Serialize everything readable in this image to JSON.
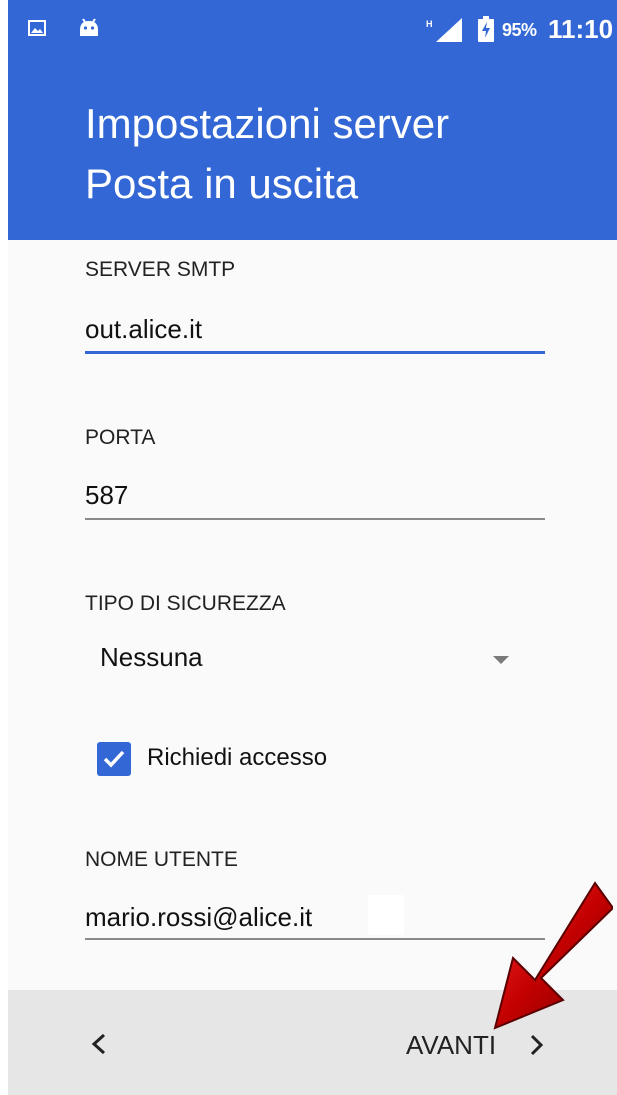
{
  "status_bar": {
    "icons_left": [
      "image-icon",
      "android-icon"
    ],
    "signal_label": "H",
    "battery_percent": "95%",
    "time": "11:10"
  },
  "header": {
    "title_line1": "Impostazioni server",
    "title_line2": "Posta in uscita"
  },
  "form": {
    "smtp": {
      "label": "SERVER SMTP",
      "value": "out.alice.it"
    },
    "port": {
      "label": "PORTA",
      "value": "587"
    },
    "security": {
      "label": "TIPO DI SICUREZZA",
      "selected": "Nessuna"
    },
    "require_login": {
      "label": "Richiedi accesso",
      "checked": true
    },
    "username": {
      "label": "NOME UTENTE",
      "value": "mario.rossi@alice.it"
    }
  },
  "footer": {
    "back_icon": "chevron-left-icon",
    "next_label": "AVANTI",
    "next_icon": "chevron-right-icon"
  },
  "colors": {
    "primary": "#3367d6",
    "annotation_arrow": "#c30000"
  }
}
